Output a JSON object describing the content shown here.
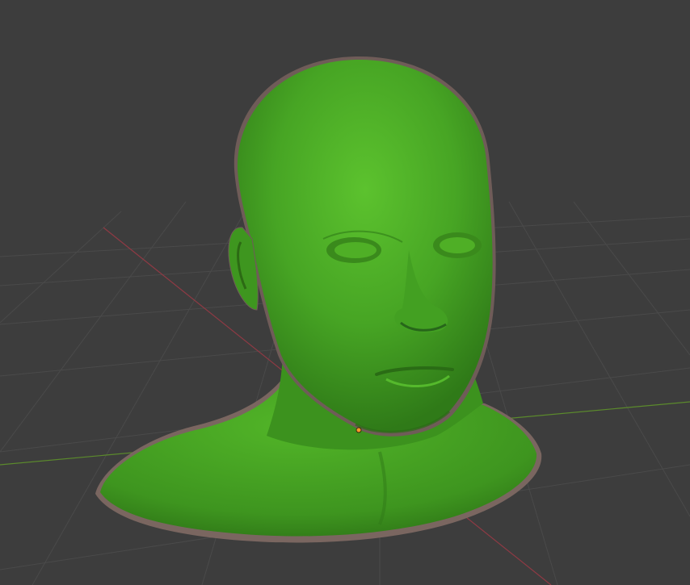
{
  "viewport": {
    "mode": "3d-viewport",
    "object_name": "head-bust-mesh",
    "colors": {
      "background": "#3d3d3d",
      "grid": "#4a4a4a",
      "x_axis": "#8f3a44",
      "y_axis": "#5b8a2c",
      "mesh": "#3f9a22",
      "mesh_outline": "#7a6660",
      "origin": "#ff9a2a"
    },
    "icons": [
      "origin-point-icon"
    ]
  }
}
